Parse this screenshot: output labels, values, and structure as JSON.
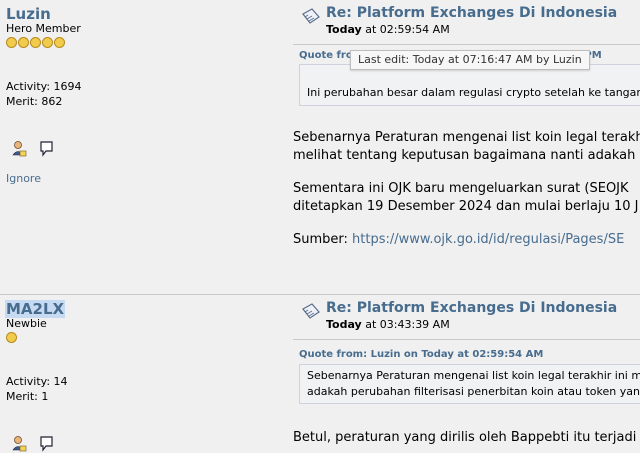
{
  "posts": [
    {
      "username": "Luzin",
      "rank": "Hero Member",
      "stars": 5,
      "activity": "Activity: 1694",
      "merit": "Merit: 862",
      "ignore": "Ignore",
      "subject": "Re: Platform Exchanges Di Indonesia",
      "date_day": "Today",
      "date_time": " at 02:59:54 AM",
      "quote_header": "Quote from",
      "quote_header_tail": "48 PM",
      "quote_text": "Ini perubahan besar dalam regulasi crypto setelah ke tangan",
      "body": [
        "Sebenarnya Peraturan mengenai list koin legal terakh",
        "melihat tentang keputusan bagaimana nanti adakah",
        "Sementara ini OJK baru mengeluarkan surat  (SEOJK",
        "ditetapkan 19 Desember 2024 dan mulai berlaju 10 J"
      ],
      "source_label": "Sumber: ",
      "source_link": "https://www.ojk.go.id/id/regulasi/Pages/SE"
    },
    {
      "username": "MA2LX",
      "rank": "Newbie",
      "stars": 1,
      "activity": "Activity: 14",
      "merit": "Merit: 1",
      "subject": "Re: Platform Exchanges Di Indonesia",
      "date_day": "Today",
      "date_time": " at 03:43:39 AM",
      "quote_header": "Quote from: Luzin on Today at 02:59:54 AM",
      "quote_lines": [
        "Sebenarnya Peraturan mengenai list koin legal terakhir ini m",
        "adakah perubahan filterisasi penerbitan koin atau token yang"
      ],
      "body": [
        "Betul, peraturan yang dirilis oleh Bappebti itu terjadi"
      ]
    }
  ],
  "tooltip": "Last edit: Today at 07:16:47 AM by Luzin",
  "icons": [
    "profile-icon",
    "message-icon"
  ],
  "colors": {
    "link": "#476c8e",
    "background": "#f0f0f0",
    "selection": "#c6daf2"
  }
}
